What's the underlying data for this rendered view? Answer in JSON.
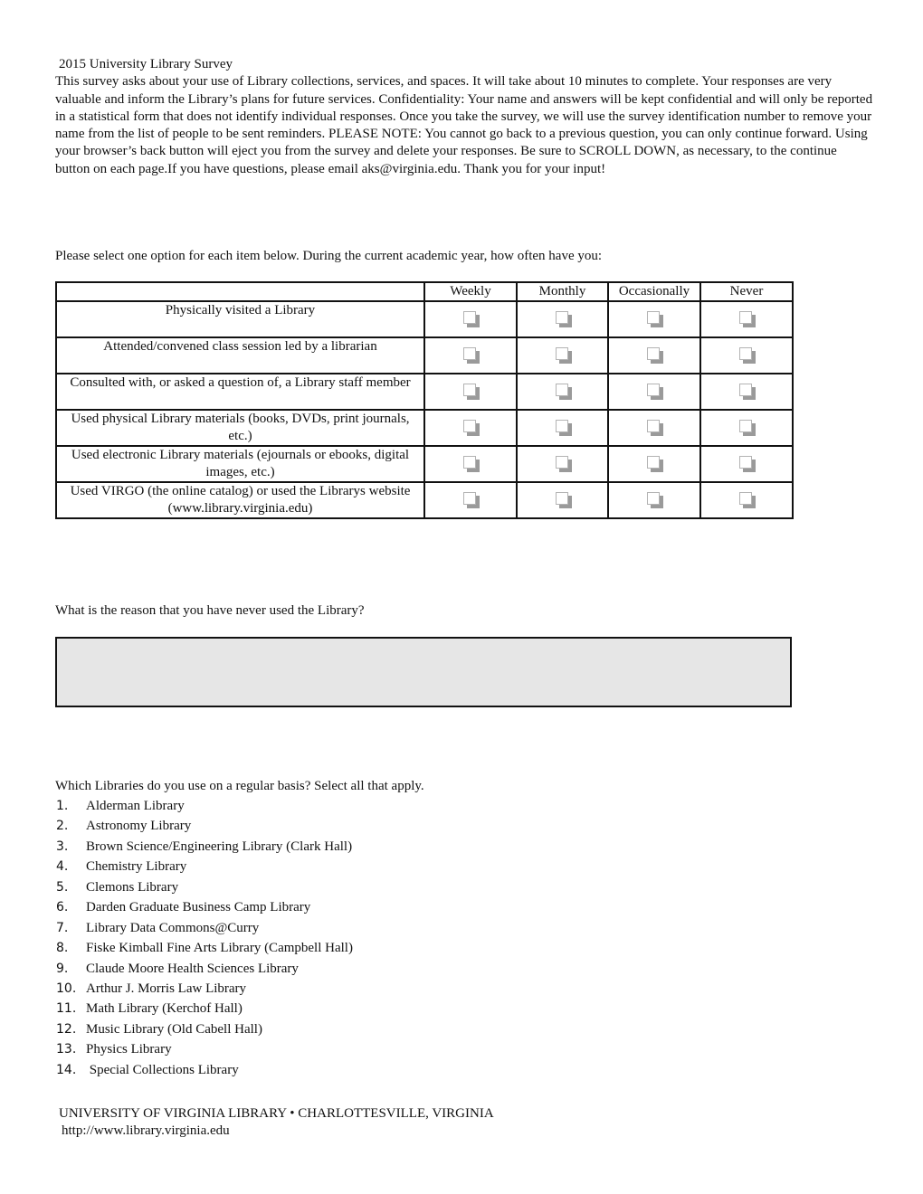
{
  "intro": {
    "title": "2015 University Library Survey",
    "paragraph": "This survey asks about your use of Library collections, services, and spaces. It will take about 10 minutes to complete. Your responses are very valuable and inform the Library’s plans for future services. Confidentiality: Your name and answers will be kept confidential and will only be reported in a statistical form that does not identify individual responses. Once you take the survey, we will use the survey identification number to remove your name from the list of people to be sent reminders. PLEASE NOTE: You cannot go back to a previous question, you can only continue forward.  Using your browser’s back button will eject you from the survey and delete your responses. Be sure to SCROLL DOWN, as necessary, to the continue button on each page.If you have questions, please email aks@virginia.edu. Thank you for your input!"
  },
  "question1": {
    "prompt": "Please select one option for each item below. During the current academic year, how often have you:",
    "columns": [
      "Weekly",
      "Monthly",
      "Occasionally",
      "Never"
    ],
    "rows": [
      {
        "label": "Physically visited a Library"
      },
      {
        "label": "Attended/convened class session led by a librarian"
      },
      {
        "label": "Consulted with, or asked a question of, a Library staff member"
      },
      {
        "label": "Used physical Library materials (books, DVDs, print journals, etc.)"
      },
      {
        "label": "Used electronic Library materials (ejournals or ebooks, digital images, etc.)"
      },
      {
        "label": "Used VIRGO (the online catalog) or used the Librarys website (www.library.virginia.edu)"
      }
    ]
  },
  "question2": {
    "prompt": "What is the reason that you have never used the Library?",
    "value": ""
  },
  "question3": {
    "prompt": "Which Libraries do you use on a regular basis? Select all that apply.",
    "options": [
      {
        "num": "1.",
        "label": "Alderman Library"
      },
      {
        "num": "2.",
        "label": "Astronomy Library"
      },
      {
        "num": "3.",
        "label": "Brown Science/Engineering Library (Clark Hall)"
      },
      {
        "num": "4.",
        "label": "Chemistry Library"
      },
      {
        "num": "5.",
        "label": "Clemons Library"
      },
      {
        "num": "6.",
        "label": "Darden Graduate Business Camp Library"
      },
      {
        "num": "7.",
        "label": "Library Data Commons@Curry"
      },
      {
        "num": "8.",
        "label": "Fiske Kimball Fine Arts Library (Campbell Hall)"
      },
      {
        "num": "9.",
        "label": "Claude Moore Health Sciences Library"
      },
      {
        "num": "10.",
        "label": "Arthur J. Morris Law Library"
      },
      {
        "num": "11.",
        "label": "Math Library (Kerchof Hall)"
      },
      {
        "num": "12.",
        "label": "Music Library (Old Cabell Hall)"
      },
      {
        "num": "13.",
        "label": "Physics Library"
      },
      {
        "num": "14.",
        "label": " Special Collections Library"
      }
    ]
  },
  "footer": {
    "org": "UNIVERSITY OF VIRGINIA LIBRARY •  CHARLOTTESVILLE, VIRGINIA",
    "url": "http://www.library.virginia.edu"
  }
}
